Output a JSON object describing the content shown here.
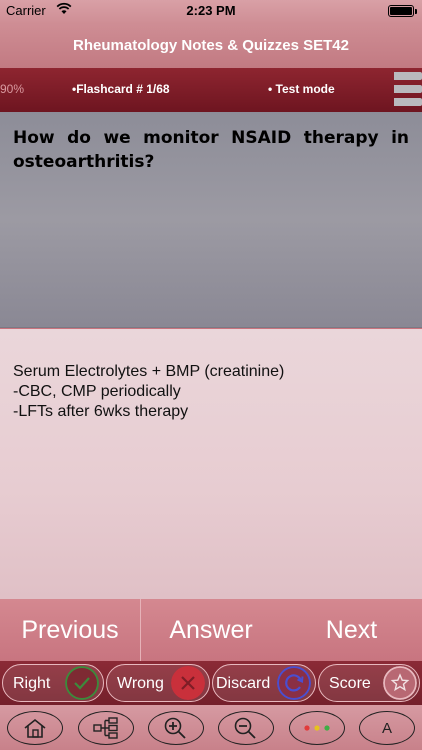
{
  "status": {
    "carrier": "Carrier",
    "time": "2:23 PM"
  },
  "header": {
    "title": "Rheumatology Notes & Quizzes SET42",
    "progress": "90%",
    "flashcard": "•Flashcard #  1/68",
    "mode": "• Test mode"
  },
  "card": {
    "question": "How do we monitor NSAID therapy in osteoarthritis?",
    "answer": "Serum Electrolytes + BMP (creatinine)\n-CBC, CMP periodically\n-LFTs after 6wks therapy"
  },
  "nav": {
    "previous": "Previous",
    "answer": "Answer",
    "next": "Next"
  },
  "marks": {
    "right": "Right",
    "wrong": "Wrong",
    "discard": "Discard",
    "score": "Score"
  },
  "tools": {
    "font_label": "A"
  },
  "colors": {
    "accent": "#7c1f2a",
    "right": "#3d8a3c",
    "wrong": "#c9303b",
    "discard": "#4a4ed0"
  }
}
